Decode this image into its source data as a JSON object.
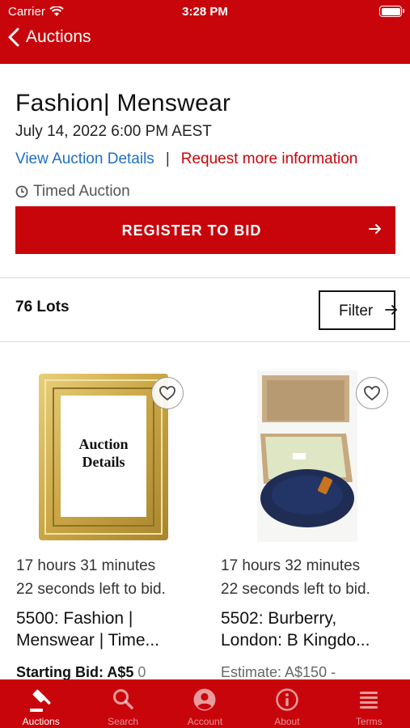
{
  "status_bar": {
    "carrier": "Carrier",
    "time": "3:28 PM"
  },
  "nav": {
    "back_label": "Auctions"
  },
  "auction": {
    "title": "Fashion| Menswear",
    "date": "July 14, 2022 6:00 PM AEST",
    "view_details": "View Auction Details",
    "separator": "|",
    "request_info": "Request more information",
    "type": "Timed Auction",
    "register_label": "REGISTER TO BID"
  },
  "lots": {
    "count_label": "76 Lots",
    "filter_label": "Filter"
  },
  "cards": [
    {
      "image_text_1": "Auction",
      "image_text_2": "Details",
      "time_left_1": "17 hours 31 minutes",
      "time_left_2": "22 seconds left to bid.",
      "name_1": "5500: Fashion |",
      "name_2": "Menswear | Time...",
      "bid_label": "Starting Bid: A$5",
      "bid_extra": "0"
    },
    {
      "time_left_1": "17 hours 32 minutes",
      "time_left_2": "22 seconds left to bid.",
      "name_1": "5502: Burberry,",
      "name_2": "London: B Kingdo...",
      "bid_label": "Estimate: A$150 -"
    }
  ],
  "tabs": [
    {
      "label": "Auctions",
      "icon": "gavel-icon"
    },
    {
      "label": "Search",
      "icon": "search-icon"
    },
    {
      "label": "Account",
      "icon": "account-icon"
    },
    {
      "label": "About",
      "icon": "info-icon"
    },
    {
      "label": "Terms",
      "icon": "terms-icon"
    }
  ],
  "colors": {
    "brand": "#c8050b",
    "link": "#1f6fc5"
  }
}
